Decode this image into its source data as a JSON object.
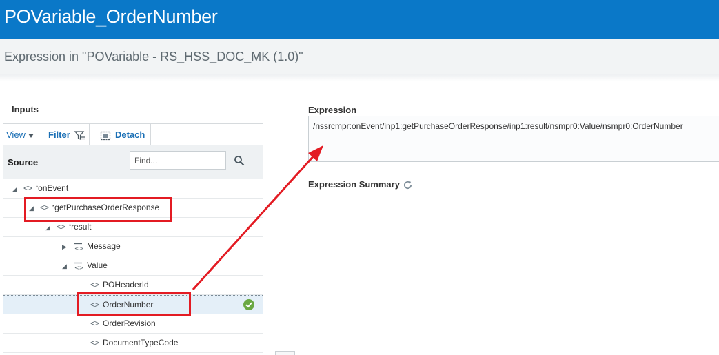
{
  "header": {
    "title": "POVariable_OrderNumber"
  },
  "subheader": {
    "title": "Expression in \"POVariable - RS_HSS_DOC_MK (1.0)\""
  },
  "inputs": {
    "label": "Inputs",
    "toolbar": {
      "view_label": "View",
      "filter_label": "Filter",
      "detach_label": "Detach"
    },
    "source": {
      "label": "Source",
      "find_placeholder": "Find..."
    },
    "tree": [
      {
        "label": "onEvent",
        "required": "*",
        "expanded": true,
        "icon": "element-icon"
      },
      {
        "label": "getPurchaseOrderResponse",
        "required": "*",
        "expanded": true,
        "icon": "element-icon",
        "annotated": true
      },
      {
        "label": "result",
        "required": "*",
        "expanded": true,
        "icon": "element-icon"
      },
      {
        "label": "Message",
        "expanded": false,
        "icon": "group-icon"
      },
      {
        "label": "Value",
        "expanded": true,
        "icon": "group-icon"
      },
      {
        "label": "POHeaderId",
        "icon": "element-icon"
      },
      {
        "label": "OrderNumber",
        "icon": "element-icon",
        "selected": true,
        "mapped": true,
        "annotated": true
      },
      {
        "label": "OrderRevision",
        "icon": "element-icon"
      },
      {
        "label": "DocumentTypeCode",
        "icon": "element-icon"
      }
    ]
  },
  "expression": {
    "label": "Expression",
    "value": "/nssrcmpr:onEvent/inp1:getPurchaseOrderResponse/inp1:result/nsmpr0:Value/nsmpr0:OrderNumber",
    "summary_label": "Expression Summary"
  },
  "colors": {
    "title_bar": "#0a78c8",
    "link": "#1a6fb5",
    "annotation": "#e31b23",
    "mapped_check": "#6aa843",
    "selected_row": "#e4eff8"
  }
}
